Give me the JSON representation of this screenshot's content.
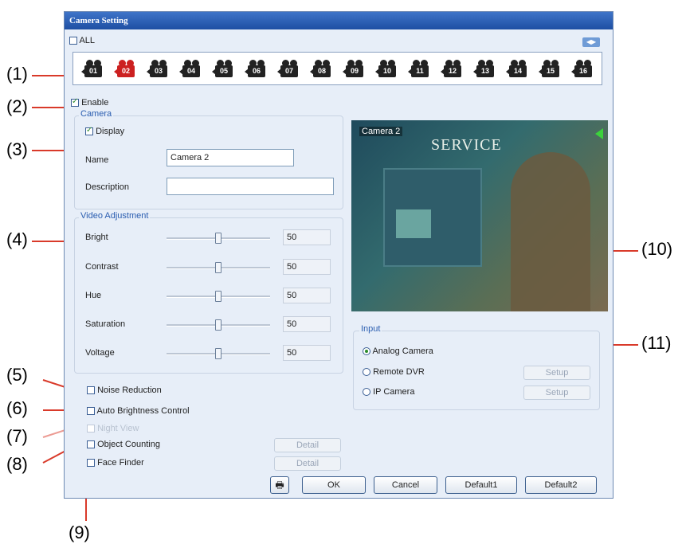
{
  "callouts": [
    "(1)",
    "(2)",
    "(3)",
    "(4)",
    "(5)",
    "(6)",
    "(7)",
    "(8)",
    "(9)",
    "(10)",
    "(11)"
  ],
  "window": {
    "title": "Camera Setting"
  },
  "all_label": "ALL",
  "cameras": [
    "01",
    "02",
    "03",
    "04",
    "05",
    "06",
    "07",
    "08",
    "09",
    "10",
    "11",
    "12",
    "13",
    "14",
    "15",
    "16"
  ],
  "selected_camera": "02",
  "enable_label": "Enable",
  "camera_group": {
    "title": "Camera",
    "display_label": "Display",
    "name_label": "Name",
    "name_value": "Camera 2",
    "description_label": "Description",
    "description_value": ""
  },
  "video_adjustment": {
    "title": "Video Adjustment",
    "rows": [
      {
        "label": "Bright",
        "value": "50"
      },
      {
        "label": "Contrast",
        "value": "50"
      },
      {
        "label": "Hue",
        "value": "50"
      },
      {
        "label": "Saturation",
        "value": "50"
      },
      {
        "label": "Voltage",
        "value": "50"
      }
    ]
  },
  "options": {
    "noise_reduction": "Noise Reduction",
    "auto_brightness": "Auto Brightness Control",
    "night_view": "Night View",
    "object_counting": "Object Counting",
    "face_finder": "Face Finder",
    "detail": "Detail"
  },
  "preview": {
    "overlay_text": "Camera 2",
    "sign_text": "SERVICE"
  },
  "input": {
    "title": "Input",
    "analog": "Analog Camera",
    "remote": "Remote DVR",
    "ip": "IP Camera",
    "setup": "Setup"
  },
  "buttons": {
    "ok": "OK",
    "cancel": "Cancel",
    "default1": "Default1",
    "default2": "Default2"
  },
  "colors": {
    "accent": "#2a5db0",
    "titlebar": "#1e4fa3",
    "selected_camera": "#cc2020",
    "callout_line": "#d93a2a"
  }
}
